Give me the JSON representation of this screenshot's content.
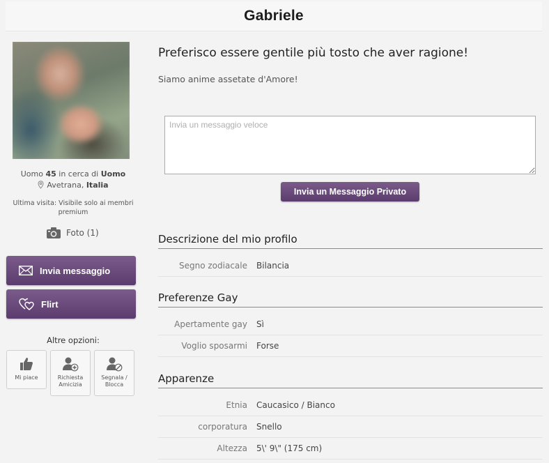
{
  "profile": {
    "name": "Gabriele",
    "gender": "Uomo",
    "age": "45",
    "seeking_label": "in cerca di",
    "seeking": "Uomo",
    "city": "Avetrana",
    "country": "Italia",
    "last_visit": "Ultima visita: Visibile solo ai membri premium",
    "photos_label": "Foto (1)"
  },
  "actions": {
    "send_message": "Invia messaggio",
    "flirt": "Flirt",
    "other_options_label": "Altre opzioni:",
    "like": "Mi piace",
    "friend_request": "Richiesta Amicizia",
    "report_block": "Segnala / Blocca"
  },
  "about": {
    "headline": "Preferisco essere gentile più tosto che aver ragione!",
    "text": "Siamo anime assetate d'Amore!"
  },
  "quick_message": {
    "placeholder": "Invia un messaggio veloce",
    "value": "",
    "send_label": "Invia un Messaggio Privato"
  },
  "sections": {
    "description": {
      "title": "Descrizione del mio profilo",
      "rows": [
        {
          "label": "Segno zodiacale",
          "value": "Bilancia"
        }
      ]
    },
    "gay_prefs": {
      "title": "Preferenze Gay",
      "rows": [
        {
          "label": "Apertamente gay",
          "value": "Sì"
        },
        {
          "label": "Voglio sposarmi",
          "value": "Forse"
        }
      ]
    },
    "appearance": {
      "title": "Apparenze",
      "rows": [
        {
          "label": "Etnia",
          "value": "Caucasico / Bianco"
        },
        {
          "label": "corporatura",
          "value": "Snello"
        },
        {
          "label": "Altezza",
          "value": "5\\' 9\\\" (175 cm)"
        }
      ]
    }
  },
  "colors": {
    "accent_top": "#7a5b8a",
    "accent_bottom": "#5b3c6e",
    "background": "#f3f3f3"
  },
  "icons": {
    "pin": "location-pin-icon",
    "camera": "camera-icon",
    "envelope": "envelope-icon",
    "hearts": "hearts-icon",
    "thumb": "thumbs-up-icon",
    "user_add": "user-add-icon",
    "user_block": "user-block-icon"
  }
}
